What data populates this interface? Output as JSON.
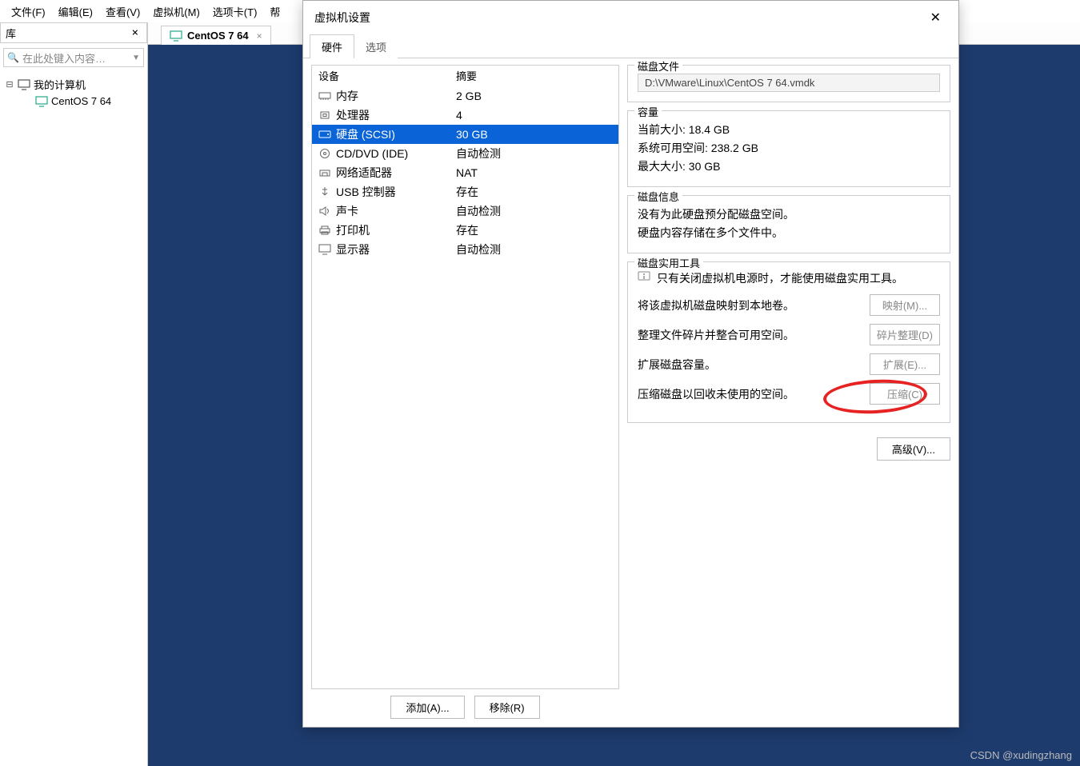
{
  "menubar": [
    "文件(F)",
    "编辑(E)",
    "查看(V)",
    "虚拟机(M)",
    "选项卡(T)",
    "帮"
  ],
  "library": {
    "title": "库",
    "search_placeholder": "在此处键入内容…",
    "root": "我的计算机",
    "item": "CentOS 7 64"
  },
  "tab": {
    "label": "CentOS 7 64"
  },
  "dialog": {
    "title": "虚拟机设置",
    "tabs": {
      "hardware": "硬件",
      "options": "选项"
    },
    "headers": {
      "device": "设备",
      "summary": "摘要"
    },
    "devices": [
      {
        "name": "内存",
        "summary": "2 GB",
        "icon": "mem"
      },
      {
        "name": "处理器",
        "summary": "4",
        "icon": "cpu"
      },
      {
        "name": "硬盘 (SCSI)",
        "summary": "30 GB",
        "icon": "hdd",
        "selected": true
      },
      {
        "name": "CD/DVD (IDE)",
        "summary": "自动检测",
        "icon": "cd"
      },
      {
        "name": "网络适配器",
        "summary": "NAT",
        "icon": "net"
      },
      {
        "name": "USB 控制器",
        "summary": "存在",
        "icon": "usb"
      },
      {
        "name": "声卡",
        "summary": "自动检测",
        "icon": "snd"
      },
      {
        "name": "打印机",
        "summary": "存在",
        "icon": "prn"
      },
      {
        "name": "显示器",
        "summary": "自动检测",
        "icon": "disp"
      }
    ],
    "buttons": {
      "add": "添加(A)...",
      "remove": "移除(R)"
    },
    "right": {
      "disk_file_label": "磁盘文件",
      "disk_file": "D:\\VMware\\Linux\\CentOS 7 64.vmdk",
      "capacity_label": "容量",
      "current_size": "当前大小: 18.4 GB",
      "free_space": "系统可用空间: 238.2 GB",
      "max_size": "最大大小: 30 GB",
      "disk_info_label": "磁盘信息",
      "disk_info_1": "没有为此硬盘预分配磁盘空间。",
      "disk_info_2": "硬盘内容存储在多个文件中。",
      "util_label": "磁盘实用工具",
      "util_note": "只有关闭虚拟机电源时，才能使用磁盘实用工具。",
      "map_text": "将该虚拟机磁盘映射到本地卷。",
      "map_btn": "映射(M)...",
      "defrag_text": "整理文件碎片并整合可用空间。",
      "defrag_btn": "碎片整理(D)",
      "expand_text": "扩展磁盘容量。",
      "expand_btn": "扩展(E)...",
      "compact_text": "压缩磁盘以回收未使用的空间。",
      "compact_btn": "压缩(C)",
      "advanced_btn": "高级(V)..."
    }
  },
  "watermark": "CSDN @xudingzhang",
  "icons": {
    "search": "🔍"
  }
}
